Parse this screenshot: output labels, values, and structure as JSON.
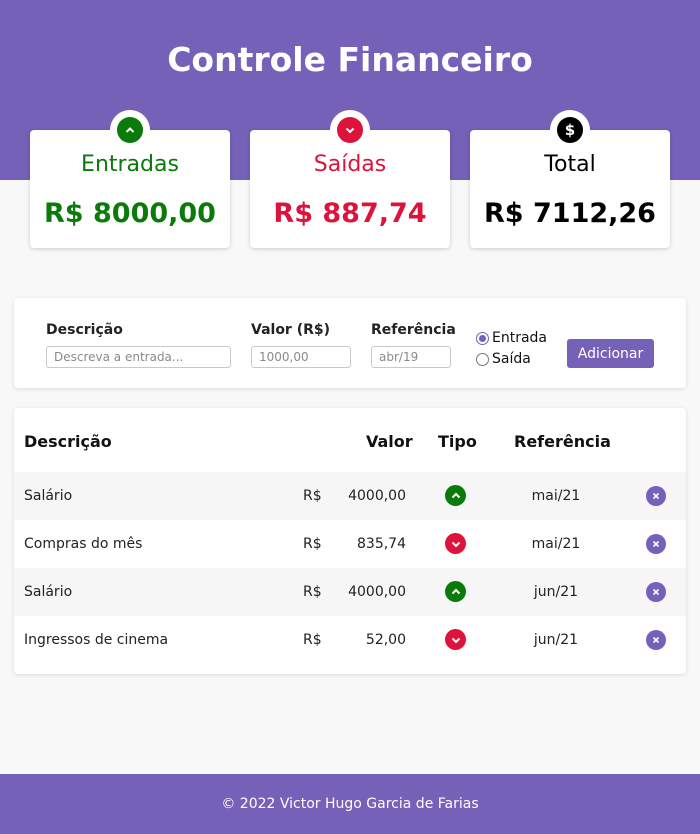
{
  "header": {
    "title": "Controle Financeiro"
  },
  "colors": {
    "accent": "#7561b8",
    "income": "#0a7a0a",
    "expense": "#dc143c",
    "total": "#000000"
  },
  "summary": {
    "income": {
      "label": "Entradas",
      "value": "R$ 8000,00",
      "icon": "chevron-up-icon"
    },
    "expense": {
      "label": "Saídas",
      "value": "R$ 887,74",
      "icon": "chevron-down-icon"
    },
    "total": {
      "label": "Total",
      "value": "R$ 7112,26",
      "icon": "dollar-icon"
    }
  },
  "form": {
    "description": {
      "label": "Descrição",
      "placeholder": "Descreva a entrada..."
    },
    "amount": {
      "label": "Valor (R$)",
      "placeholder": "1000,00"
    },
    "reference": {
      "label": "Referência",
      "placeholder": "abr/19"
    },
    "type_options": [
      {
        "label": "Entrada",
        "selected": true
      },
      {
        "label": "Saída",
        "selected": false
      }
    ],
    "submit_label": "Adicionar"
  },
  "table": {
    "headers": {
      "description": "Descrição",
      "amount": "Valor",
      "type": "Tipo",
      "reference": "Referência"
    },
    "currency": "R$",
    "rows": [
      {
        "description": "Salário",
        "amount": "4000,00",
        "type": "entrada",
        "reference": "mai/21"
      },
      {
        "description": "Compras do mês",
        "amount": "835,74",
        "type": "saida",
        "reference": "mai/21"
      },
      {
        "description": "Salário",
        "amount": "4000,00",
        "type": "entrada",
        "reference": "jun/21"
      },
      {
        "description": "Ingressos de cinema",
        "amount": "52,00",
        "type": "saida",
        "reference": "jun/21"
      }
    ]
  },
  "footer": {
    "text": "© 2022 Victor Hugo Garcia de Farias"
  }
}
